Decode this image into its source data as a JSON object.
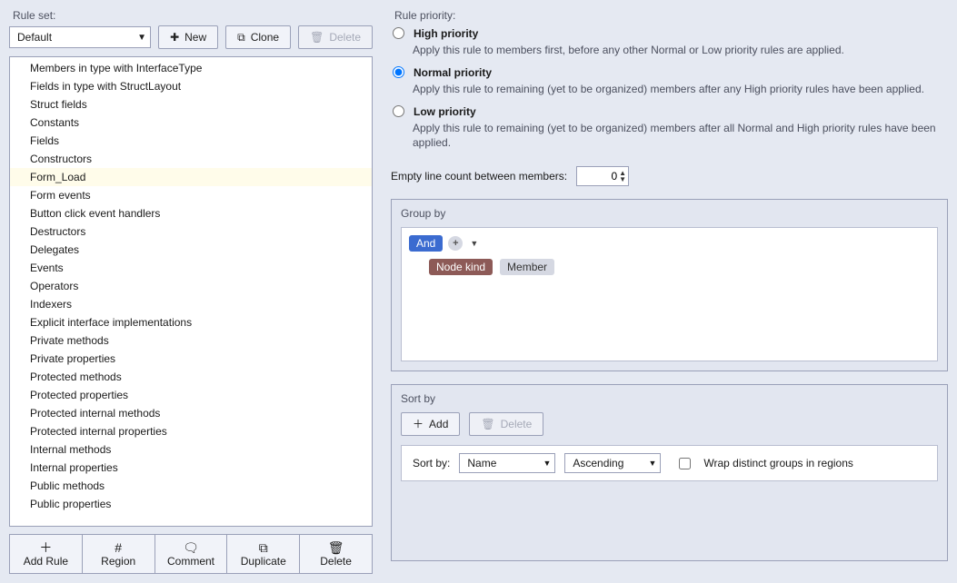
{
  "left": {
    "title": "Rule set:",
    "ruleset_selected": "Default",
    "new_btn": "New",
    "clone_btn": "Clone",
    "delete_btn": "Delete",
    "rules": [
      "Members in type with InterfaceType",
      "Fields in type with StructLayout",
      "Struct fields",
      "Constants",
      "Fields",
      "Constructors",
      "Form_Load",
      "Form events",
      "Button click event handlers",
      "Destructors",
      "Delegates",
      "Events",
      "Operators",
      "Indexers",
      "Explicit interface implementations",
      "Private methods",
      "Private properties",
      "Protected methods",
      "Protected properties",
      "Protected internal methods",
      "Protected internal properties",
      "Internal methods",
      "Internal properties",
      "Public methods",
      "Public properties"
    ],
    "selected_rule": "Form_Load",
    "toolbar": {
      "add_rule": "Add Rule",
      "region": "Region",
      "comment": "Comment",
      "duplicate": "Duplicate",
      "delete": "Delete"
    }
  },
  "right": {
    "title": "Rule priority:",
    "priorities": [
      {
        "label": "High priority",
        "desc": "Apply this rule to members first, before any other Normal or Low priority rules are applied."
      },
      {
        "label": "Normal priority",
        "desc": "Apply this rule to remaining (yet to be organized) members after any High priority rules have been applied."
      },
      {
        "label": "Low priority",
        "desc": "Apply this rule to remaining (yet to be organized) members after all Normal and High priority rules have been applied."
      }
    ],
    "selected_priority_index": 1,
    "empty_line_label": "Empty line count between members:",
    "empty_line_value": "0",
    "groupby": {
      "title": "Group by",
      "and_label": "And",
      "node_kind": "Node kind",
      "member": "Member"
    },
    "sortby": {
      "title": "Sort by",
      "add_btn": "Add",
      "delete_btn": "Delete",
      "row_label": "Sort by:",
      "field": "Name",
      "order": "Ascending",
      "wrap_label": "Wrap distinct groups in regions"
    }
  }
}
